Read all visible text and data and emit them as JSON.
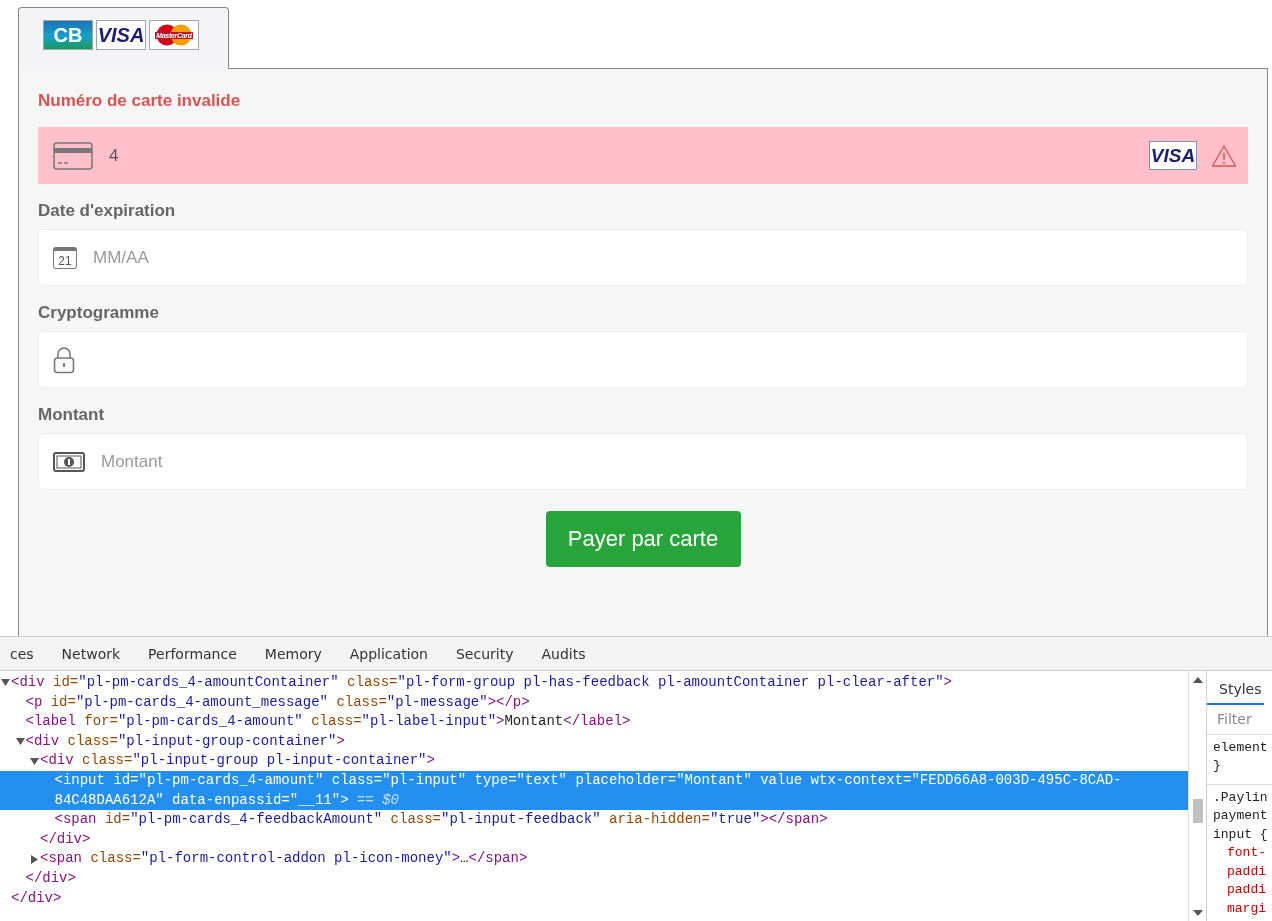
{
  "card_tab": {
    "logos": [
      {
        "kind": "cb",
        "text": "CB"
      },
      {
        "kind": "visa",
        "text": "VISA"
      },
      {
        "kind": "mastercard",
        "text": "MasterCard"
      }
    ]
  },
  "form": {
    "fields": [
      {
        "kind": "card",
        "message": "Numéro de carte invalide",
        "value": "4",
        "invalid": true,
        "brand": "VISA"
      },
      {
        "kind": "date",
        "label": "Date d'expiration",
        "placeholder": "MM/AA",
        "icon_text": "21",
        "invalid": false
      },
      {
        "kind": "cvv",
        "label": "Cryptogramme",
        "invalid": false
      },
      {
        "kind": "amount",
        "label": "Montant",
        "placeholder": "Montant",
        "invalid": false
      }
    ],
    "submit": "Payer par carte"
  },
  "devtools": {
    "tabs": [
      {
        "label": "ces",
        "selected": false
      },
      {
        "label": "Network",
        "selected": false
      },
      {
        "label": "Performance",
        "selected": false
      },
      {
        "label": "Memory",
        "selected": false
      },
      {
        "label": "Application",
        "selected": false
      },
      {
        "label": "Security",
        "selected": false
      },
      {
        "label": "Audits",
        "selected": false
      }
    ],
    "tree": [
      {
        "text": "<div id=\"pl-pm-cards_4-amountContainer\" class=\"pl-form-group pl-has-feedback pl-amountContainer pl-clear-after\">",
        "expanded": true,
        "selected": false,
        "close": "</div>",
        "children": [
          {
            "text": "<p id=\"pl-pm-cards_4-amount_message\" class=\"pl-message\"></p>",
            "selected": false
          },
          {
            "text": "<label for=\"pl-pm-cards_4-amount\" class=\"pl-label-input\">Montant</label>",
            "selected": false
          },
          {
            "text": "<div class=\"pl-input-group-container\">",
            "expanded": true,
            "selected": false,
            "close": "</div>",
            "children": [
              {
                "text": "<div class=\"pl-input-group pl-input-container\">",
                "expanded": true,
                "selected": false,
                "close": "</div>",
                "children": [
                  {
                    "text": "<input id=\"pl-pm-cards_4-amount\" class=\"pl-input\" type=\"text\" placeholder=\"Montant\" value wtx-context=\"FEDD66A8-003D-495C-8CAD-84C48DAA612A\" data-enpassid=\"__11\">",
                    "marker": "== $0",
                    "selected": true
                  },
                  {
                    "text": "<span id=\"pl-pm-cards_4-feedbackAmount\" class=\"pl-input-feedback\" aria-hidden=\"true\"></span>",
                    "selected": false
                  }
                ]
              },
              {
                "text": "<span class=\"pl-form-control-addon pl-icon-money\">…</span>",
                "expanded": false,
                "selected": false
              }
            ]
          }
        ]
      }
    ],
    "styles": {
      "tab": "Styles",
      "filter_placeholder": "Filter",
      "rules": [
        {
          "lines": [
            {
              "kind": "selector",
              "text": "element"
            },
            {
              "kind": "brace",
              "text": "}"
            }
          ]
        },
        {
          "lines": [
            {
              "kind": "selector",
              "text": ".Paylin"
            },
            {
              "kind": "selector",
              "text": "payment"
            },
            {
              "kind": "selector",
              "text": "input {"
            },
            {
              "kind": "property",
              "text": "font-"
            },
            {
              "kind": "property",
              "text": "paddi"
            },
            {
              "kind": "property",
              "text": "paddi"
            },
            {
              "kind": "property",
              "text": "margi"
            }
          ]
        }
      ]
    }
  }
}
